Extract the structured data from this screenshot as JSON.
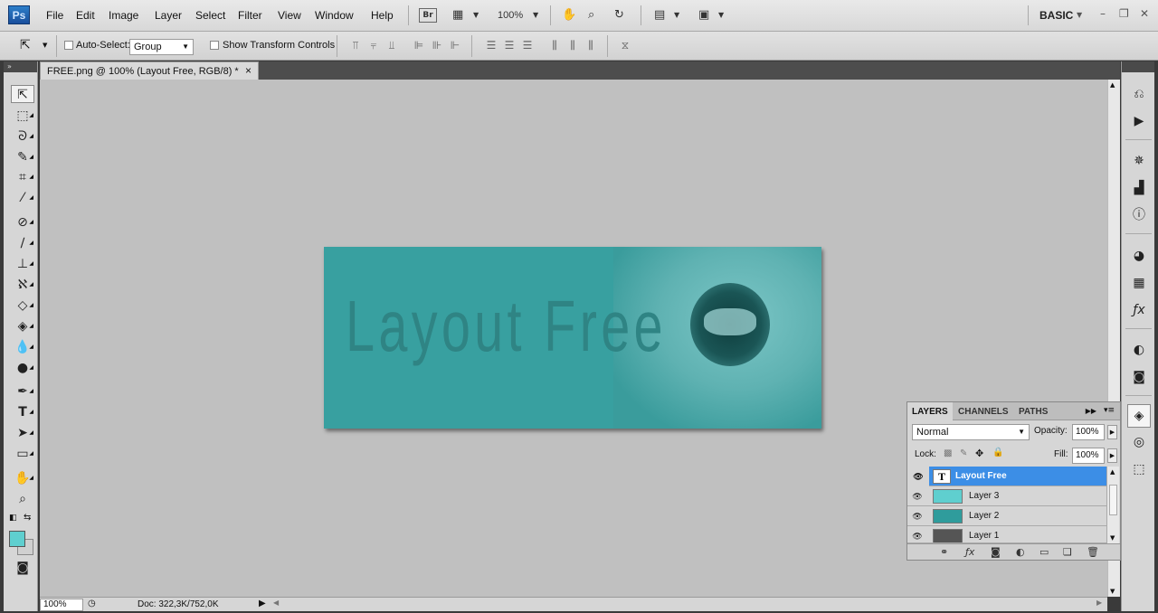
{
  "app": {
    "logo": "Ps",
    "workspace": "BASIC"
  },
  "menu": [
    "File",
    "Edit",
    "Image",
    "Layer",
    "Select",
    "Filter",
    "View",
    "Window",
    "Help"
  ],
  "menubar": {
    "bridge_label": "Br",
    "zoom": "100%"
  },
  "options": {
    "auto_select_label": "Auto-Select:",
    "auto_select_value": "Group",
    "transform_label": "Show Transform Controls"
  },
  "document": {
    "tab_title": "FREE.png @ 100% (Layout Free, RGB/8) *",
    "close": "×"
  },
  "canvas": {
    "banner_text": "Layout Free",
    "colors": {
      "banner": "#38a0a0",
      "foreground": "#5fcfcf"
    }
  },
  "status": {
    "zoom": "100%",
    "doc_size": "Doc: 322,3K/752,0K"
  },
  "layers_panel": {
    "tabs": [
      "LAYERS",
      "CHANNELS",
      "PATHS"
    ],
    "blend_mode": "Normal",
    "opacity_label": "Opacity:",
    "opacity_value": "100%",
    "lock_label": "Lock:",
    "fill_label": "Fill:",
    "fill_value": "100%",
    "layers": [
      {
        "name": "Layout Free",
        "type": "text",
        "selected": true
      },
      {
        "name": "Layer 3",
        "color": "#5fcfcf"
      },
      {
        "name": "Layer 2",
        "color": "#2f9c9c"
      },
      {
        "name": "Layer 1",
        "color": "#555555"
      }
    ]
  }
}
